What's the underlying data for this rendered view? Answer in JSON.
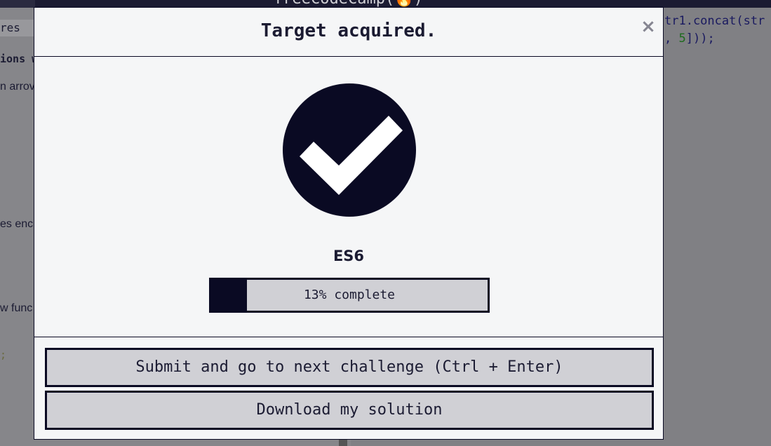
{
  "background": {
    "nav_title": "freeCodeCamp(🔥)",
    "tab_label": "res",
    "lines": [
      "ions w",
      "n arrov",
      "es enc",
      "w func"
    ],
    "code_line_1": "tr1.concat(str",
    "code_line_2_a": ", ",
    "code_line_2_num": "5",
    "code_line_2_b": "]));"
  },
  "modal": {
    "title": "Target acquired.",
    "close_label": "×",
    "icon": "check-circle-icon",
    "block_name": "ES6",
    "progress_percent": 13,
    "progress_text": "13% complete",
    "submit_label": "Submit and go to next challenge (Ctrl + Enter)",
    "download_label": "Download my solution"
  },
  "colors": {
    "dark": "#0a0a23",
    "modal_bg": "#f5f6f7",
    "button_bg": "#d0d0d5"
  }
}
